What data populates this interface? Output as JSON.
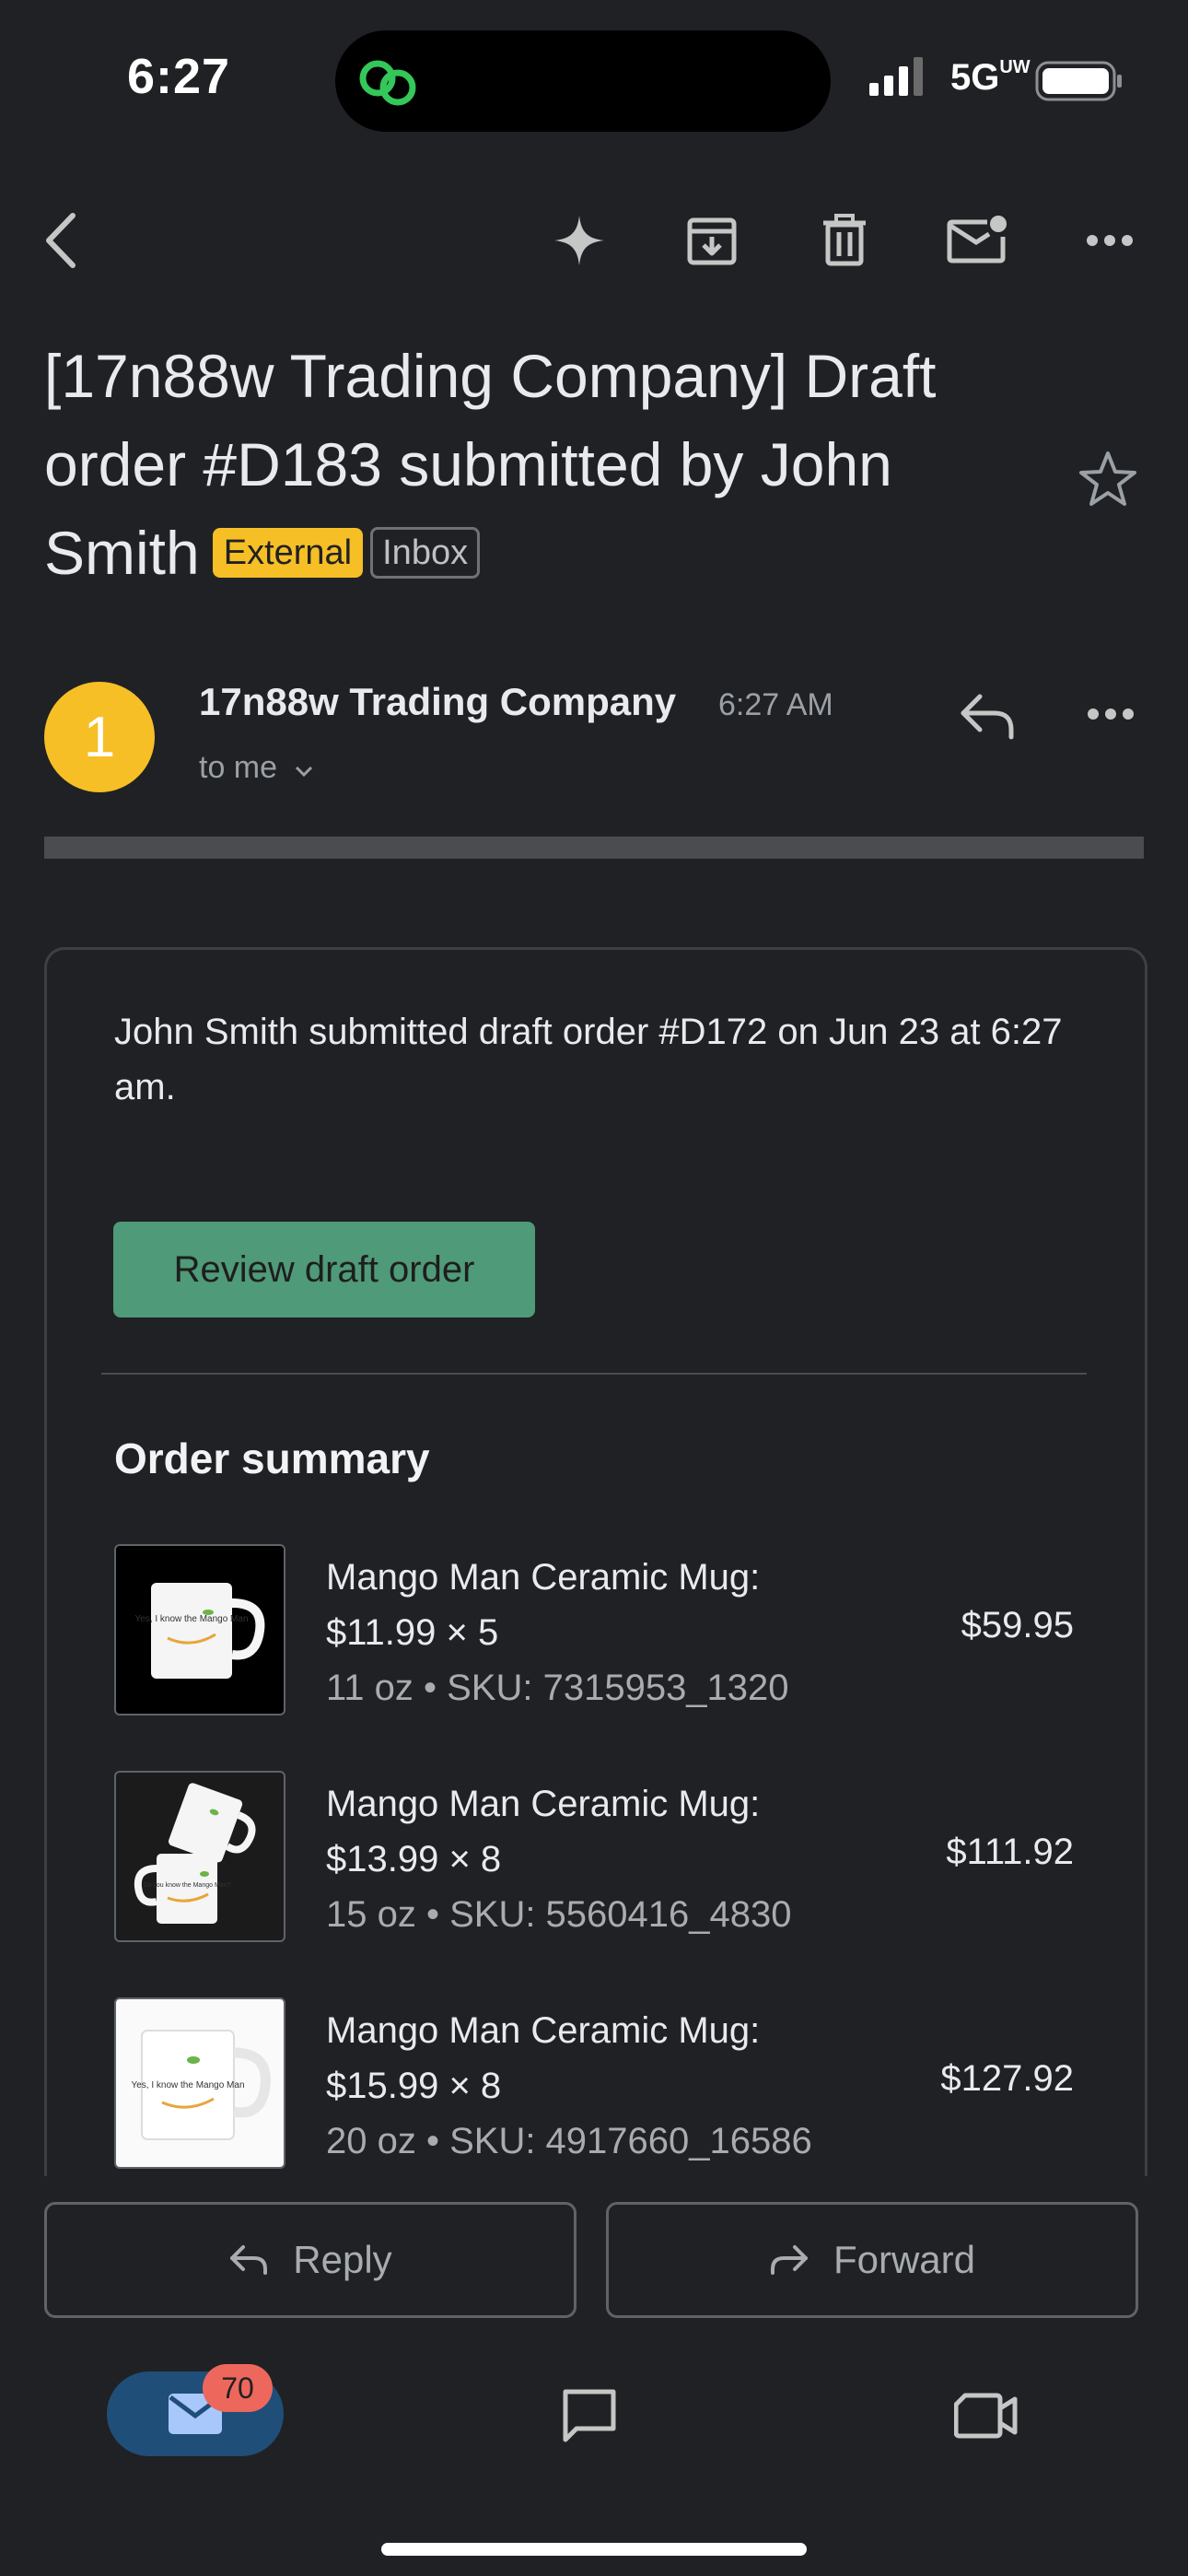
{
  "status_bar": {
    "time": "6:27",
    "network": "5G",
    "network_sup": "UW"
  },
  "toolbar": {
    "back": "back-arrow-icon",
    "gemini": "sparkle-icon",
    "archive": "archive-icon",
    "delete": "trash-icon",
    "mark_unread": "mark-unread-icon",
    "more": "more-horizontal-icon"
  },
  "email": {
    "subject": "[17n88w Trading Company] Draft order #D183 submitted by John Smith",
    "label_external": "External",
    "label_inbox": "Inbox",
    "sender_initial": "1",
    "sender_name": "17n88w Trading Company",
    "time": "6:27 AM",
    "recipient": "to me"
  },
  "body": {
    "intro": "John Smith submitted draft order #D172 on Jun 23 at 6:27 am.",
    "review_button": "Review draft order",
    "summary_title": "Order summary",
    "items": [
      {
        "name": "Mango Man Ceramic Mug:",
        "price_qty": "$11.99 × 5",
        "details": "11 oz • SKU: 7315953_1320",
        "total": "$59.95",
        "mug_text": "Yes, I know the Mango Man"
      },
      {
        "name": "Mango Man Ceramic Mug:",
        "price_qty": "$13.99 × 8",
        "details": "15 oz • SKU: 5560416_4830",
        "total": "$111.92",
        "mug_text": "Do you know the Mango Man?"
      },
      {
        "name": "Mango Man Ceramic Mug:",
        "price_qty": "$15.99 × 8",
        "details": "20 oz • SKU: 4917660_16586",
        "total": "$127.92",
        "mug_text": "Yes, I know the Mango Man"
      }
    ]
  },
  "actions": {
    "reply": "Reply",
    "forward": "Forward"
  },
  "bottom_nav": {
    "mail_badge": "70"
  },
  "colors": {
    "background": "#202124",
    "accent_button": "#4f9a78",
    "avatar": "#f6bf26",
    "badge_external": "#f6bf26",
    "nav_active": "#1f4e79",
    "badge_count": "#ee675c"
  }
}
